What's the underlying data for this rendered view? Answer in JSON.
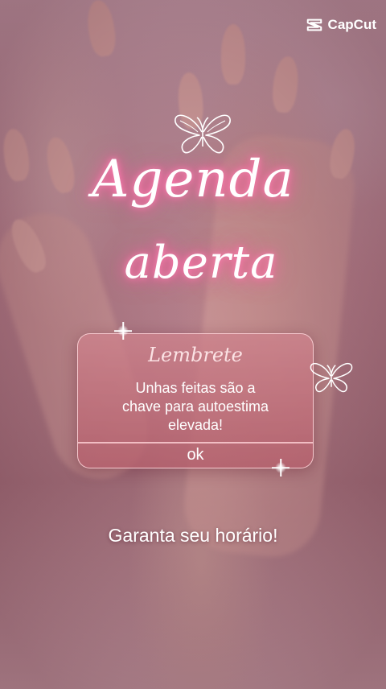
{
  "brand": {
    "name": "CapCut",
    "icon": "capcut-logo-icon"
  },
  "title": {
    "line1": "Agenda",
    "line2": "aberta"
  },
  "card": {
    "heading": "Lembrete",
    "line1": "Unhas feitas são a",
    "line2": "chave para autoestima",
    "line3": "elevada!",
    "button": "ok"
  },
  "cta": "Garanta seu horário!",
  "colors": {
    "glow": "#ff5fa0",
    "card": "#c0707e",
    "text": "#ffffff"
  },
  "decorations": [
    "butterfly-icon",
    "butterfly-icon",
    "sparkle-icon",
    "sparkle-icon"
  ]
}
